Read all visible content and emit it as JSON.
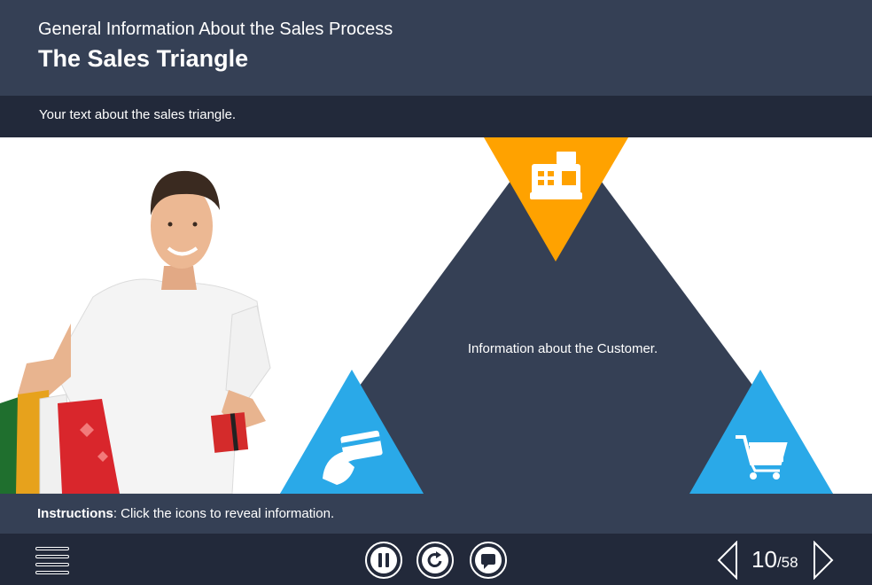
{
  "header": {
    "subtitle": "General Information About the Sales Process",
    "title": "The Sales Triangle"
  },
  "intro": {
    "text": "Your text about the sales triangle."
  },
  "triangle": {
    "center_text": "Information about the Customer.",
    "top_icon": "cash-register-icon",
    "left_icon": "card-payment-icon",
    "right_icon": "shopping-cart-icon"
  },
  "instructions": {
    "label": "Instructions",
    "separator": ":",
    "text": " Click the icons to reveal information."
  },
  "footer": {
    "menu_icon": "hamburger-menu-icon",
    "pause_icon": "pause-icon",
    "replay_icon": "replay-icon",
    "comment_icon": "comment-icon",
    "current_page": "10",
    "total_pages": "/58"
  },
  "colors": {
    "header_bg": "#354055",
    "bar_bg": "#22293a",
    "triangle": "#354055",
    "accent_orange": "#ffa200",
    "accent_blue": "#2aa9e8"
  }
}
